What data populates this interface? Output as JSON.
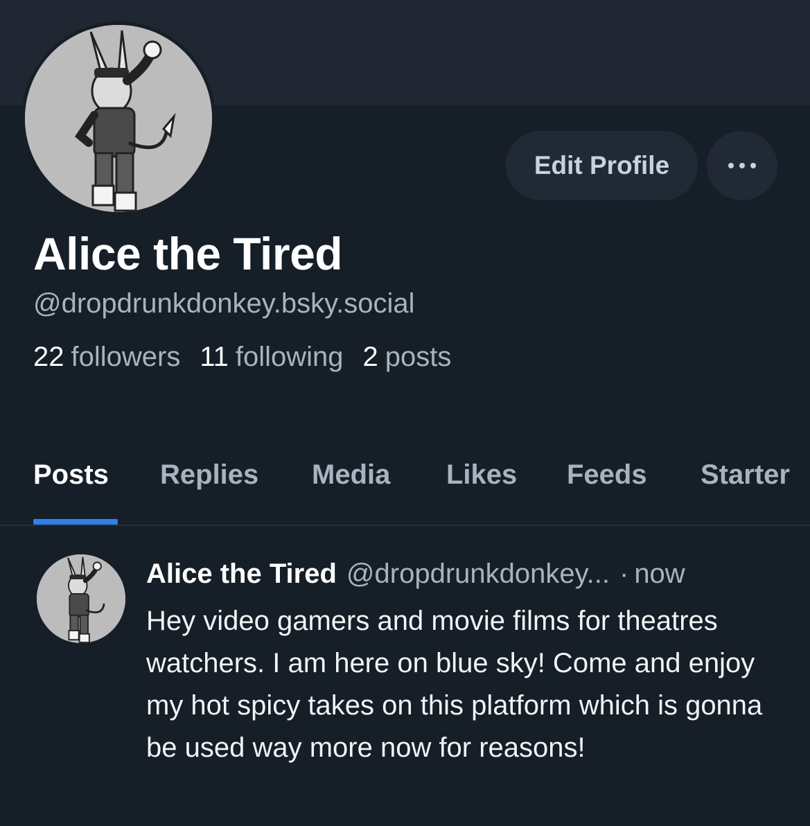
{
  "colors": {
    "background": "#161e27",
    "banner": "#202733",
    "accent": "#2f80ed",
    "muted_text": "#a8b3c0"
  },
  "profile": {
    "display_name": "Alice the Tired",
    "handle": "@dropdrunkdonkey.bsky.social",
    "avatar_icon": "donkey-character-avatar",
    "stats": {
      "followers_count": "22",
      "followers_label": "followers",
      "following_count": "11",
      "following_label": "following",
      "posts_count": "2",
      "posts_label": "posts"
    }
  },
  "actions": {
    "edit_profile_label": "Edit Profile",
    "more_icon": "ellipsis-icon"
  },
  "tabs": [
    {
      "label": "Posts",
      "active": true
    },
    {
      "label": "Replies",
      "active": false
    },
    {
      "label": "Media",
      "active": false
    },
    {
      "label": "Likes",
      "active": false
    },
    {
      "label": "Feeds",
      "active": false
    },
    {
      "label": "Starter",
      "active": false
    }
  ],
  "post": {
    "author": "Alice the Tired",
    "handle": "@dropdrunkdonkey...",
    "separator": "·",
    "time": "now",
    "text": "Hey video gamers and movie films for theatres watchers. I am here on blue sky! Come and enjoy my hot spicy takes on this platform which is gonna be used way more now for reasons!"
  }
}
